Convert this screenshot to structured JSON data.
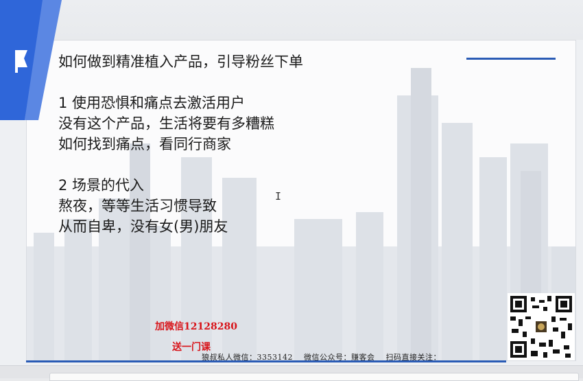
{
  "slide": {
    "lines": [
      "如何做到精准植入产品，引导粉丝下单",
      "",
      "1 使用恐惧和痛点去激活用户",
      "没有这个产品，生活将要有多糟糕",
      "如何找到痛点，看同行商家",
      "",
      "2 场景的代入",
      "熬夜，等等生活习惯导致",
      "从而自卑，没有女(男)朋友"
    ]
  },
  "promo": {
    "line1": "加微信12128280",
    "line2": "送一门课"
  },
  "footer": {
    "text": "狼叔私人微信：3353142    微信公众号：赚客会    扫码直接关注："
  },
  "colors": {
    "accent": "#2a5bb5",
    "promo": "#d8141a",
    "deco_blue": "#2f66d9"
  },
  "icons": {
    "corner": "flag-icon",
    "qr": "qr-code-icon",
    "cursor": "text-cursor-icon"
  }
}
